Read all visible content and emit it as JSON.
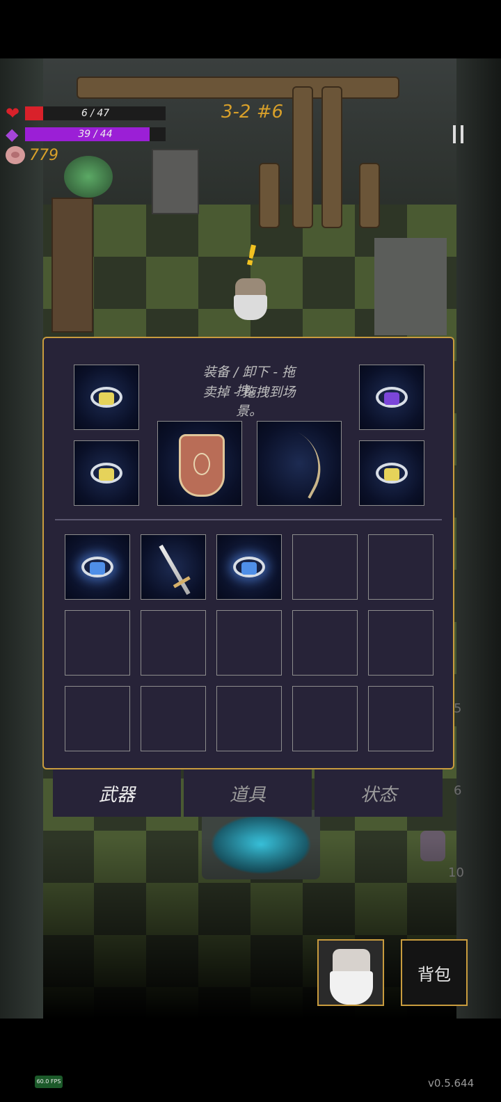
{
  "hud": {
    "hp": {
      "current": 6,
      "max": 47,
      "text": "6 / 47",
      "color": "#d9212a"
    },
    "mana": {
      "current": 39,
      "max": 44,
      "text": "39 / 44",
      "color": "#9b1fd6"
    },
    "coins": "779"
  },
  "level_label": "3-2 #6",
  "panel": {
    "hint_line1": "装备 / 卸下 - 拖拽。",
    "hint_line2": "卖掉 - 拖拽到场景。",
    "equipped": {
      "ring_top_left": {
        "icon": "ring-yellow-gem-icon",
        "gem_color": "#e6d35a"
      },
      "ring_bottom_left": {
        "icon": "ring-yellow-gem-icon",
        "gem_color": "#e6d35a"
      },
      "ring_top_right": {
        "icon": "ring-purple-gem-icon",
        "gem_color": "#7b46d9"
      },
      "ring_bottom_right": {
        "icon": "ring-yellow-gem-icon",
        "gem_color": "#e6d35a"
      },
      "offhand": {
        "icon": "winged-shield-icon"
      },
      "weapon": {
        "icon": "bow-icon"
      }
    },
    "inventory": [
      {
        "icon": "ring-blue-gem-icon",
        "gem_color": "#4f8fe8"
      },
      {
        "icon": "sword-icon"
      },
      {
        "icon": "ring-blue-gem-icon",
        "gem_color": "#4f8fe8"
      },
      {},
      {},
      {},
      {},
      {},
      {},
      {},
      {},
      {},
      {},
      {},
      {}
    ]
  },
  "tabs": [
    {
      "label": "武器",
      "active": true
    },
    {
      "label": "道具",
      "active": false
    },
    {
      "label": "状态",
      "active": false
    }
  ],
  "side_numbers": [
    "5",
    "6",
    "10"
  ],
  "bag_label": "背包",
  "fps": "60.0 FPS",
  "version": "v0.5.644"
}
